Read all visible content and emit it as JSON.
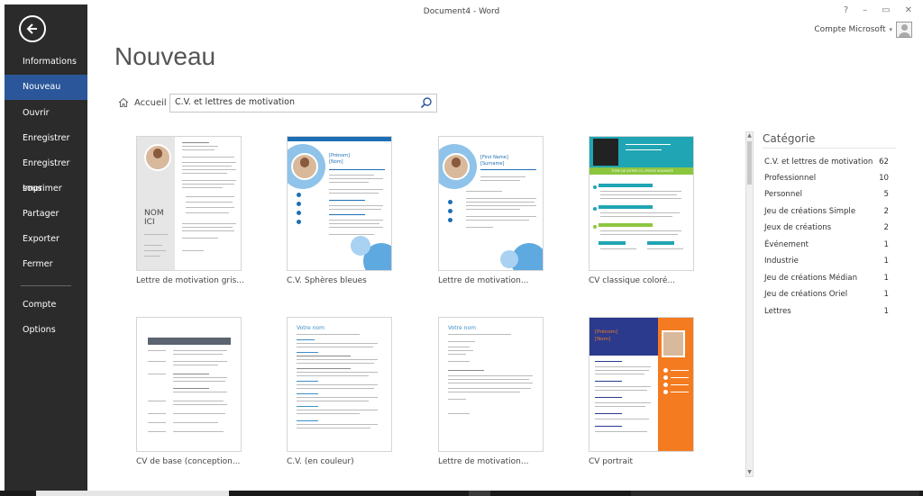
{
  "window": {
    "title": "Document4 - Word",
    "controls": [
      "?",
      "–",
      "▭",
      "✕"
    ],
    "account_label": "Compte Microsoft"
  },
  "sidebar": {
    "items": [
      {
        "label": "Informations",
        "active": false
      },
      {
        "label": "Nouveau",
        "active": true
      },
      {
        "label": "Ouvrir",
        "active": false
      },
      {
        "label": "Enregistrer",
        "active": false
      },
      {
        "label": "Enregistrer sous",
        "active": false
      },
      {
        "label": "Imprimer",
        "active": false
      },
      {
        "label": "Partager",
        "active": false
      },
      {
        "label": "Exporter",
        "active": false
      },
      {
        "label": "Fermer",
        "active": false
      },
      {
        "label": "Compte",
        "active": false
      },
      {
        "label": "Options",
        "active": false
      }
    ]
  },
  "header": {
    "title": "Nouveau",
    "home_label": "Accueil",
    "search_value": "C.V. et lettres de motivation"
  },
  "templates": [
    {
      "name": "Lettre de motivation gris...",
      "photo_text_1": "NOM",
      "photo_text_2": "ICI"
    },
    {
      "name": "C.V. Sphères bleues",
      "heading_1": "[Prénom]",
      "heading_2": "[Nom]"
    },
    {
      "name": "Lettre de motivation...",
      "heading_1": "[First Name]",
      "heading_2": "[Surname]"
    },
    {
      "name": "CV classique coloré...",
      "banner": "TITRE DE VOTRE CV / POSTE SOUHAITÉ"
    },
    {
      "name": "CV de base (conception..."
    },
    {
      "name": "C.V. (en couleur)",
      "heading_1": "Votre nom"
    },
    {
      "name": "Lettre de motivation...",
      "heading_1": "Votre nom"
    },
    {
      "name": "CV portrait",
      "heading_1": "[Prénom]",
      "heading_2": "[Nom]"
    }
  ],
  "categories": {
    "title": "Catégorie",
    "items": [
      {
        "label": "C.V. et lettres de motivation",
        "count": "62"
      },
      {
        "label": "Professionnel",
        "count": "10"
      },
      {
        "label": "Personnel",
        "count": "5"
      },
      {
        "label": "Jeu de créations Simple",
        "count": "2"
      },
      {
        "label": "Jeux de créations",
        "count": "2"
      },
      {
        "label": "Événement",
        "count": "1"
      },
      {
        "label": "Industrie",
        "count": "1"
      },
      {
        "label": "Jeu de créations Médian",
        "count": "1"
      },
      {
        "label": "Jeu de créations Oriel",
        "count": "1"
      },
      {
        "label": "Lettres",
        "count": "1"
      }
    ]
  },
  "colors": {
    "sidebar_bg": "#2b2b2b",
    "accent": "#2b579a",
    "teal": "#1fa5b3",
    "green": "#8cc63f",
    "orange": "#f47b20"
  },
  "icons": {
    "back": "back-arrow-icon",
    "home": "home-icon",
    "search": "search-icon",
    "avatar": "user-icon"
  }
}
